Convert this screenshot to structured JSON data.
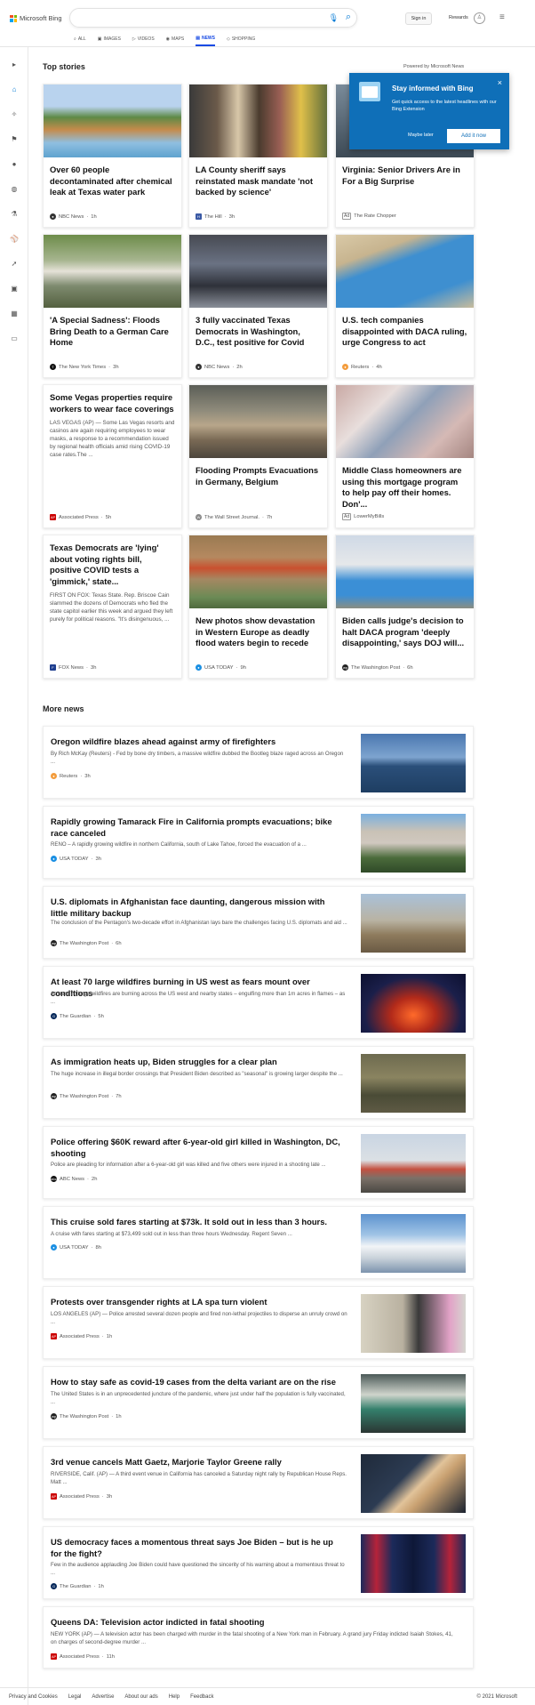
{
  "header": {
    "brand": "Microsoft Bing",
    "signin": "Sign in",
    "rewards": "Rewards",
    "nav": [
      {
        "label": "ALL",
        "icon": "search-icon",
        "active": false
      },
      {
        "label": "IMAGES",
        "icon": "image-icon",
        "active": false
      },
      {
        "label": "VIDEOS",
        "icon": "video-icon",
        "active": false
      },
      {
        "label": "MAPS",
        "icon": "map-pin-icon",
        "active": false
      },
      {
        "label": "NEWS",
        "icon": "news-icon",
        "active": true
      },
      {
        "label": "SHOPPING",
        "icon": "tag-icon",
        "active": false
      }
    ]
  },
  "sidebar_icons": [
    "expand-icon",
    "home-icon",
    "sparkle-icon",
    "flag-icon",
    "pin-icon",
    "globe-icon",
    "science-icon",
    "sports-icon",
    "rocket-icon",
    "video-icon",
    "money-icon",
    "card-icon"
  ],
  "top_stories": {
    "title": "Top stories",
    "powered_by": "Powered by Microsoft News",
    "cards": [
      {
        "title": "Over 60 people decontaminated after chemical leak at Texas water park",
        "desc": "",
        "source": "NBC News",
        "time": "1h",
        "ad": false
      },
      {
        "title": "LA County sheriff says reinstated mask mandate 'not backed by science'",
        "desc": "",
        "source": "The Hill",
        "time": "3h",
        "ad": false
      },
      {
        "title": "Virginia: Senior Drivers Are in For a Big Surprise",
        "desc": "",
        "source": "The Rate Chopper",
        "time": "",
        "ad": true
      },
      {
        "title": "'A Special Sadness': Floods Bring Death to a German Care Home",
        "desc": "",
        "source": "The New York Times",
        "time": "3h",
        "ad": false
      },
      {
        "title": "3 fully vaccinated Texas Democrats in Washington, D.C., test positive for Covid",
        "desc": "",
        "source": "NBC News",
        "time": "2h",
        "ad": false
      },
      {
        "title": "U.S. tech companies disappointed with DACA ruling, urge Congress to act",
        "desc": "",
        "source": "Reuters",
        "time": "4h",
        "ad": false
      },
      {
        "title": "Some Vegas properties require workers to wear face coverings",
        "desc": "LAS VEGAS (AP) — Some Las Vegas resorts and casinos are again requiring employees to wear masks, a response to a recommendation issued by regional health officials amid rising COVID-19 case rates.The ...",
        "source": "Associated Press",
        "time": "5h",
        "ad": false
      },
      {
        "title": "Flooding Prompts Evacuations in Germany, Belgium",
        "desc": "",
        "source": "The Wall Street Journal.",
        "time": "7h",
        "ad": false
      },
      {
        "title": "Middle Class homeowners are using this mortgage program to help pay off their homes. Don'...",
        "desc": "",
        "source": "LowerMyBills",
        "time": "",
        "ad": true
      },
      {
        "title": "Texas Democrats are 'lying' about voting rights bill, positive COVID tests a 'gimmick,' state...",
        "desc": "FIRST ON FOX: Texas State. Rep. Briscoe Cain slammed the dozens of Democrats who fled the state capitol earlier this week and argued they left purely for political reasons. \"It's disingenuous, ...",
        "source": "FOX News",
        "time": "3h",
        "ad": false
      },
      {
        "title": "New photos show devastation in Western Europe as deadly flood waters begin to recede",
        "desc": "",
        "source": "USA TODAY",
        "time": "9h",
        "ad": false
      },
      {
        "title": "Biden calls judge's decision to halt DACA program 'deeply disappointing,' says DOJ will...",
        "desc": "",
        "source": "The Washington Post",
        "time": "6h",
        "ad": false
      }
    ]
  },
  "popup": {
    "title": "Stay informed with Bing",
    "desc": "Get quick access to the latest headlines with our Bing Extension",
    "later": "Maybe later",
    "add": "Add it now",
    "close": "×"
  },
  "more_news": {
    "title": "More news",
    "items": [
      {
        "title": "Oregon wildfire blazes ahead against army of firefighters",
        "desc": "By Rich McKay (Reuters) - Fed by bone dry timbers, a massive wildfire dubbed the Bootleg blaze raged across an Oregon ...",
        "source": "Reuters",
        "time": "3h"
      },
      {
        "title": "Rapidly growing Tamarack Fire in California prompts evacuations; bike race canceled",
        "desc": "RENO – A rapidly growing wildfire in northern California, south of Lake Tahoe, forced the evacuation of a ...",
        "source": "USA TODAY",
        "time": "3h"
      },
      {
        "title": "U.S. diplomats in Afghanistan face daunting, dangerous mission with little military backup",
        "desc": "The conclusion of the Pentagon's two-decade effort in Afghanistan lays bare the challenges facing U.S. diplomats and aid ...",
        "source": "The Washington Post",
        "time": "6h"
      },
      {
        "title": "At least 70 large wildfires burning in US west as fears mount over conditions",
        "desc": "At least 70 large wildfires are burning across the US west and nearby states – engulfing more than 1m acres in flames – as ...",
        "source": "The Guardian",
        "time": "5h"
      },
      {
        "title": "As immigration heats up, Biden struggles for a clear plan",
        "desc": "The huge increase in illegal border crossings that President Biden described as \"seasonal\" is growing larger despite the ...",
        "source": "The Washington Post",
        "time": "7h"
      },
      {
        "title": "Police offering $60K reward after 6-year-old girl killed in Washington, DC, shooting",
        "desc": "Police are pleading for information after a 6-year-old girl was killed and five others were injured in a shooting late ...",
        "source": "ABC News",
        "time": "2h"
      },
      {
        "title": "This cruise sold fares starting at $73k. It sold out in less than 3 hours.",
        "desc": "A cruise with fares starting at $73,499 sold out in less than three hours Wednesday. Regent Seven ...",
        "source": "USA TODAY",
        "time": "8h"
      },
      {
        "title": "Protests over transgender rights at LA spa turn violent",
        "desc": "LOS ANGELES (AP) — Police arrested several dozen people and fired non-lethal projectiles to disperse an unruly crowd on ...",
        "source": "Associated Press",
        "time": "1h"
      },
      {
        "title": "How to stay safe as covid-19 cases from the delta variant are on the rise",
        "desc": "The United States is in an unprecedented juncture of the pandemic, where just under half the population is fully vaccinated, ...",
        "source": "The Washington Post",
        "time": "1h"
      },
      {
        "title": "3rd venue cancels Matt Gaetz, Marjorie Taylor Greene rally",
        "desc": "RIVERSIDE, Calif. (AP) — A third event venue in California has canceled a Saturday night rally by Republican House Reps. Matt ...",
        "source": "Associated Press",
        "time": "3h"
      },
      {
        "title": "US democracy faces a momentous threat says Joe Biden – but is he up for the fight?",
        "desc": "Few in the audience applauding Joe Biden could have questioned the sincerity of his warning about a momentous threat to ...",
        "source": "The Guardian",
        "time": "1h"
      },
      {
        "title": "Queens DA: Television actor indicted in fatal shooting",
        "desc": "NEW YORK (AP) — A television actor has been charged with murder in the fatal shooting of a New York man in February. A grand jury Friday indicted Isaiah Stokes, 41, on charges of second-degree murder ...",
        "source": "Associated Press",
        "time": "11h"
      }
    ]
  },
  "footer": {
    "links": [
      "Privacy and Cookies",
      "Legal",
      "Advertise",
      "About our ads",
      "Help",
      "Feedback"
    ],
    "copyright": "© 2021 Microsoft"
  }
}
